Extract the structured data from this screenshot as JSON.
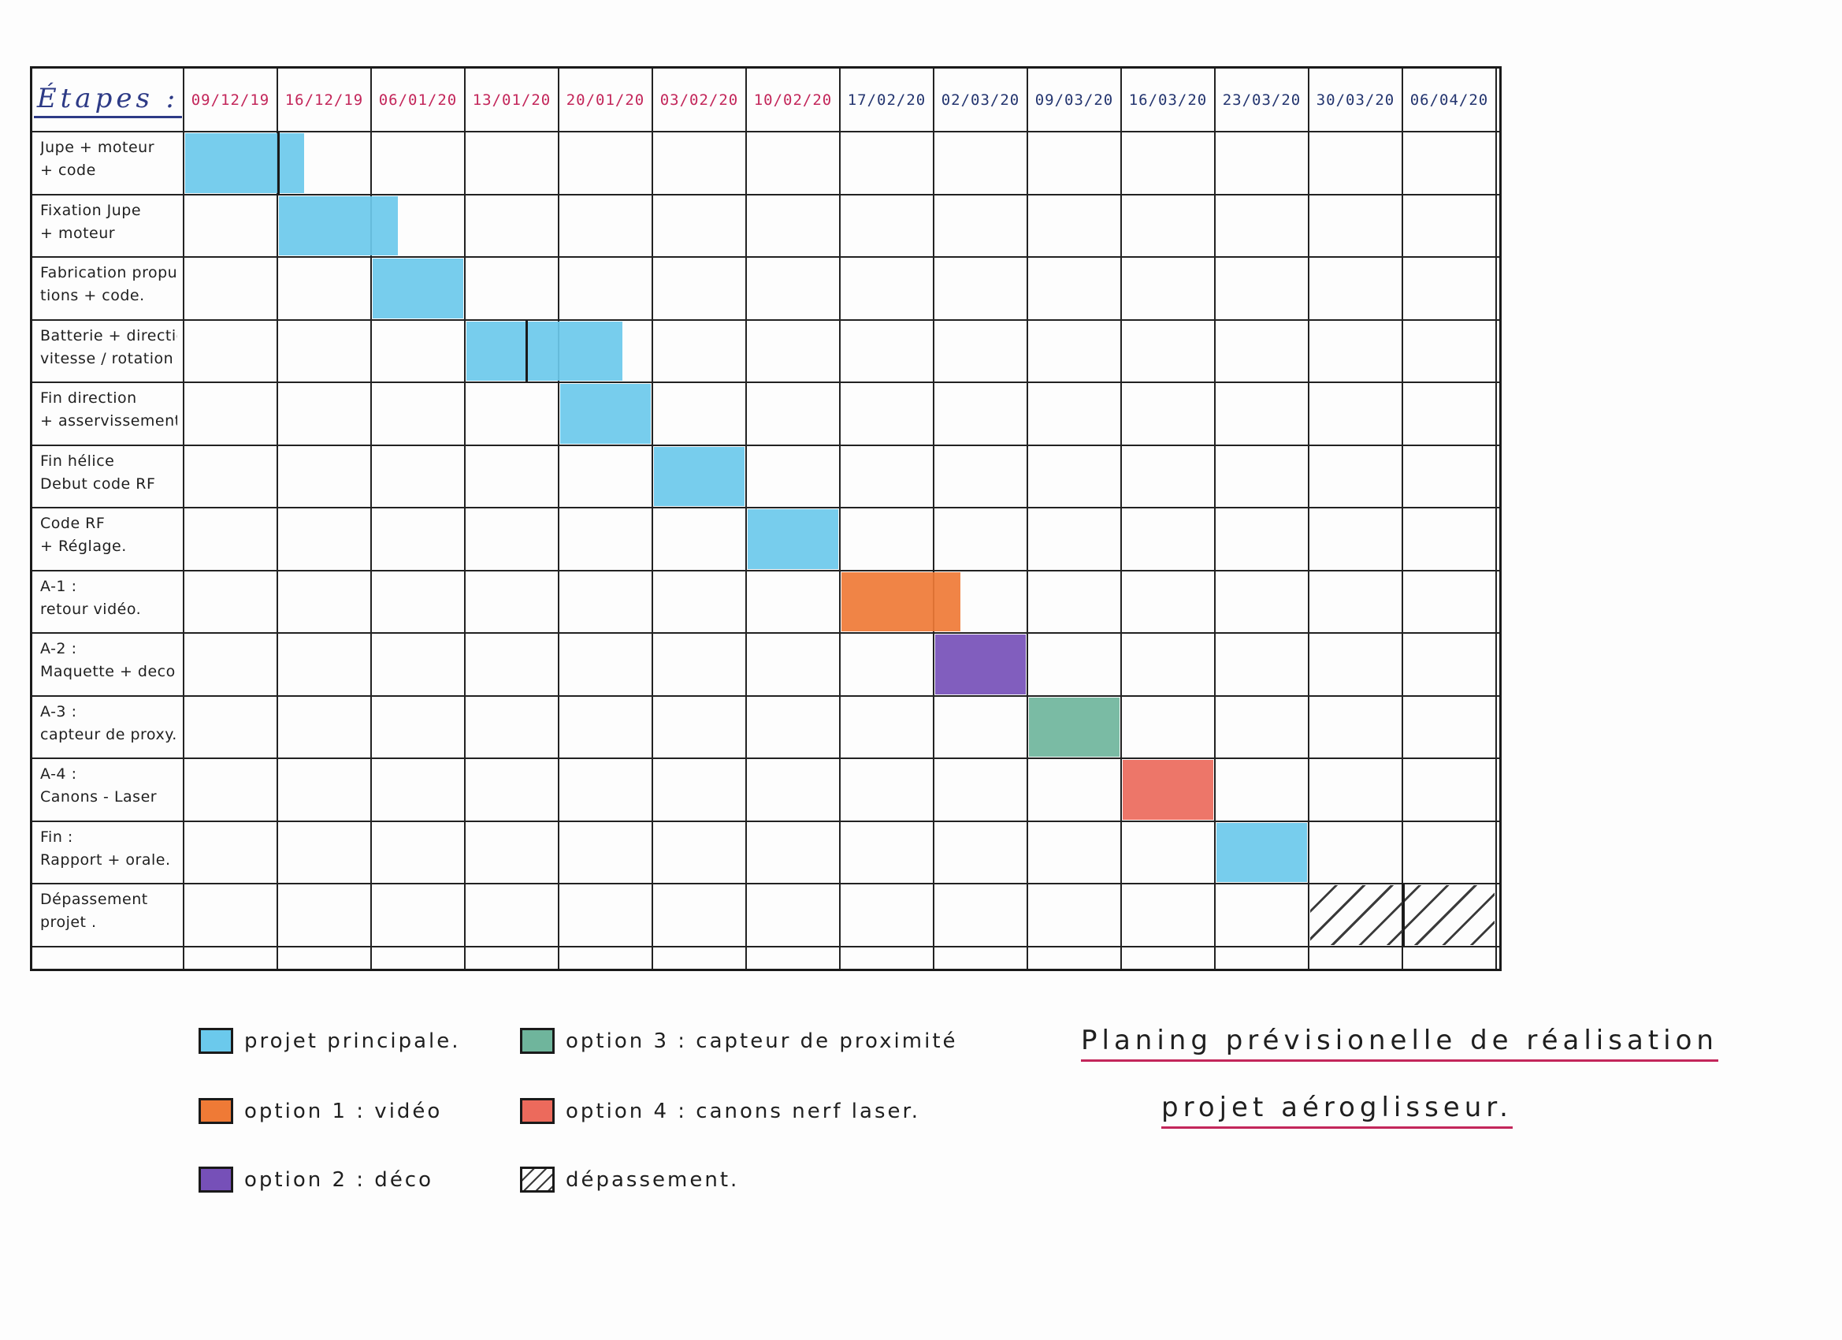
{
  "gantt": {
    "steps_header": "Étapes :",
    "dates": [
      {
        "label": "09/12/19",
        "color": "red"
      },
      {
        "label": "16/12/19",
        "color": "red"
      },
      {
        "label": "06/01/20",
        "color": "red"
      },
      {
        "label": "13/01/20",
        "color": "red"
      },
      {
        "label": "20/01/20",
        "color": "red"
      },
      {
        "label": "03/02/20",
        "color": "red"
      },
      {
        "label": "10/02/20",
        "color": "red"
      },
      {
        "label": "17/02/20",
        "color": "blue"
      },
      {
        "label": "02/03/20",
        "color": "blue"
      },
      {
        "label": "09/03/20",
        "color": "blue"
      },
      {
        "label": "16/03/20",
        "color": "blue"
      },
      {
        "label": "23/03/20",
        "color": "blue"
      },
      {
        "label": "30/03/20",
        "color": "blue"
      },
      {
        "label": "06/04/20",
        "color": "blue"
      }
    ],
    "steps": [
      {
        "lines": [
          "Jupe + moteur",
          "+ code"
        ],
        "category": "main",
        "start": 0,
        "span": 1.3,
        "split": 1
      },
      {
        "lines": [
          "Fixation Jupe",
          "+ moteur"
        ],
        "category": "main",
        "start": 1,
        "span": 1.3
      },
      {
        "lines": [
          "Fabrication propul-",
          "tions + code."
        ],
        "category": "main",
        "start": 2,
        "span": 1
      },
      {
        "lines": [
          "Batterie + direction",
          "vitesse / rotation"
        ],
        "category": "main",
        "start": 3,
        "span": 1.7,
        "split": 0.65
      },
      {
        "lines": [
          "Fin direction",
          "+ asservissement hélice."
        ],
        "category": "main",
        "start": 4,
        "span": 1
      },
      {
        "lines": [
          "Fin hélice",
          "Debut code RF"
        ],
        "category": "main",
        "start": 5,
        "span": 1
      },
      {
        "lines": [
          "Code RF",
          "+ Réglage."
        ],
        "category": "main",
        "start": 6,
        "span": 1
      },
      {
        "lines": [
          "A-1 :",
          "retour vidéo."
        ],
        "category": "opt1",
        "start": 7,
        "span": 1.3
      },
      {
        "lines": [
          "A-2 :",
          "Maquette + deco"
        ],
        "category": "opt2",
        "start": 8,
        "span": 1
      },
      {
        "lines": [
          "A-3 :",
          "capteur de proxy."
        ],
        "category": "opt3",
        "start": 9,
        "span": 1
      },
      {
        "lines": [
          "A-4 :",
          "Canons - Laser"
        ],
        "category": "opt4",
        "start": 10,
        "span": 1
      },
      {
        "lines": [
          "Fin :",
          "Rapport + orale."
        ],
        "category": "main",
        "start": 11,
        "span": 1
      },
      {
        "lines": [
          "Dépassement",
          "projet ."
        ],
        "category": "overrun",
        "start": 12,
        "span": 2,
        "split": 1
      }
    ]
  },
  "legend": [
    {
      "key": "main",
      "label": "projet principale.",
      "icon": "swatch-cyan"
    },
    {
      "key": "opt1",
      "label": "option 1 : vidéo",
      "icon": "swatch-orange"
    },
    {
      "key": "opt2",
      "label": "option 2 : déco",
      "icon": "swatch-purple"
    },
    {
      "key": "opt3",
      "label": "option 3 : capteur de proximité",
      "icon": "swatch-teal"
    },
    {
      "key": "opt4",
      "label": "option 4 : canons nerf laser.",
      "icon": "swatch-red"
    },
    {
      "key": "overrun",
      "label": "dépassement.",
      "icon": "swatch-hatched"
    }
  ],
  "title": {
    "line1": "Planing prévisionelle de réalisation",
    "line2": "projet aéroglisseur."
  },
  "colors": {
    "main": "#6bc9ec",
    "opt1": "#ef7a36",
    "opt2": "#7650b8",
    "opt3": "#6fb59c",
    "opt4": "#ec6a5c",
    "accent_pink": "#c3265a",
    "ink_blue": "#2d3a86"
  }
}
